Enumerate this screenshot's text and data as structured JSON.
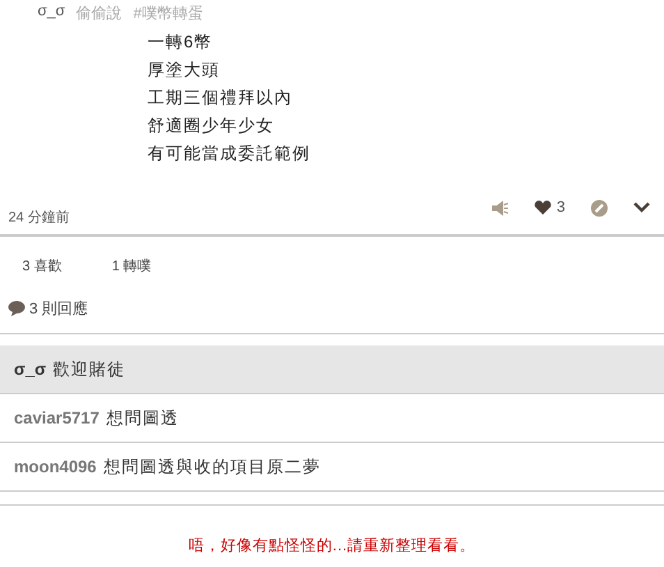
{
  "post": {
    "author": "σ_σ",
    "qualifier": "偷偷說",
    "tag": "#噗幣轉蛋",
    "lines": [
      "一轉6幣",
      "厚塗大頭",
      "工期三個禮拜以內",
      "舒適圈少年少女",
      "有可能當成委託範例"
    ],
    "time": "24 分鐘前",
    "likes": "3"
  },
  "stats": [
    {
      "label": "3 喜歡"
    },
    {
      "label": "1 轉噗"
    }
  ],
  "responses_count": "3 則回應",
  "replies": [
    {
      "author": "σ_σ",
      "text": "歡迎賭徒",
      "highlighted": true
    },
    {
      "author": "caviar5717",
      "text": "想問圖透",
      "highlighted": false
    },
    {
      "author": "moon4096",
      "text": "想問圖透與收的項目原二夢",
      "highlighted": false
    }
  ],
  "error": "唔，好像有點怪怪的...請重新整理看看。"
}
